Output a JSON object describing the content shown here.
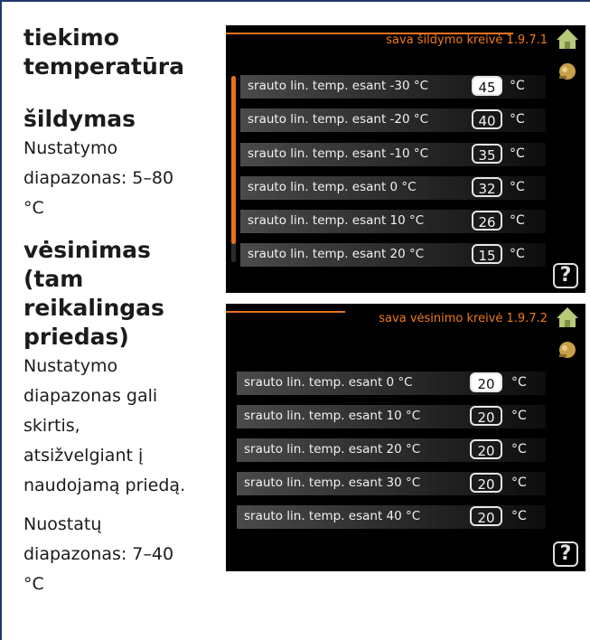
{
  "text": {
    "heading": [
      "tiekimo",
      "temperatūra"
    ],
    "heating_title": "šildymas",
    "heating_desc": [
      "Nustatymo",
      "diapazonas: 5–80",
      "°C"
    ],
    "cooling_title": [
      "vėsinimas",
      "(tam",
      "reikalingas",
      "priedas)"
    ],
    "cooling_desc": [
      "Nustatymo",
      "diapazonas gali",
      "skirtis,",
      "atsižvelgiant į",
      "naudojamą priedą."
    ],
    "settings_desc": [
      "Nuostatų",
      "diapazonas: 7–40",
      "°C"
    ]
  },
  "screen_heating": {
    "title": "sava šildymo kreivė 1.9.7.1",
    "icons": [
      "house-icon",
      "knob-icon",
      "help-icon"
    ],
    "help_label": "?",
    "rows": [
      {
        "label": "srauto lin. temp. esant -30 °C",
        "value": "45",
        "unit": "°C",
        "selected": true
      },
      {
        "label": "srauto lin. temp. esant -20 °C",
        "value": "40",
        "unit": "°C",
        "selected": false
      },
      {
        "label": "srauto lin. temp. esant -10 °C",
        "value": "35",
        "unit": "°C",
        "selected": false
      },
      {
        "label": "srauto lin. temp. esant 0 °C",
        "value": "32",
        "unit": "°C",
        "selected": false
      },
      {
        "label": "srauto lin. temp. esant 10 °C",
        "value": "26",
        "unit": "°C",
        "selected": false
      },
      {
        "label": "srauto lin. temp. esant 20 °C",
        "value": "15",
        "unit": "°C",
        "selected": false
      }
    ]
  },
  "screen_cooling": {
    "title": "sava vėsinimo kreivė 1.9.7.2",
    "icons": [
      "house-icon",
      "knob-icon",
      "help-icon"
    ],
    "help_label": "?",
    "rows": [
      {
        "label": "srauto lin. temp. esant 0 °C",
        "value": "20",
        "unit": "°C",
        "selected": true
      },
      {
        "label": "srauto lin. temp. esant 10 °C",
        "value": "20",
        "unit": "°C",
        "selected": false
      },
      {
        "label": "srauto lin. temp. esant 20 °C",
        "value": "20",
        "unit": "°C",
        "selected": false
      },
      {
        "label": "srauto lin. temp. esant 30 °C",
        "value": "20",
        "unit": "°C",
        "selected": false
      },
      {
        "label": "srauto lin. temp. esant 40 °C",
        "value": "20",
        "unit": "°C",
        "selected": false
      }
    ]
  },
  "colors": {
    "frame": "#1f3a6b",
    "accent": "#e8711a",
    "screen_bg": "#000000",
    "row_text": "#f2f2f2"
  }
}
